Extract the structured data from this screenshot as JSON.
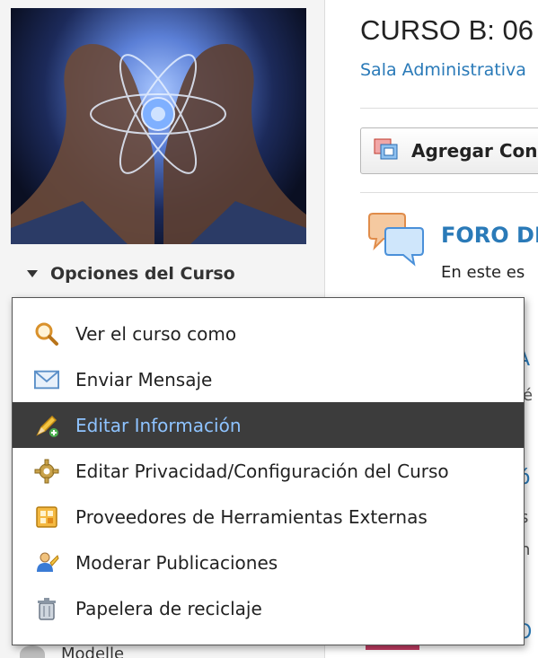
{
  "sidebar": {
    "options_label": "Opciones del Curso",
    "bottom_label": "Modelle"
  },
  "main": {
    "course_title": "CURSO B: 06",
    "course_subtitle": "Sala Administrativa",
    "add_button_label": "Agregar Con",
    "forum_title": "FORO DE",
    "forum_desc": "En este es",
    "fragment_a": "A",
    "fragment_ie": "ié",
    "fragment_o1": "ó",
    "fragment_s": "s",
    "fragment_n": "n",
    "fragment_o2": "O"
  },
  "menu": {
    "items": [
      {
        "label": "Ver el curso como",
        "icon": "magnifier-icon"
      },
      {
        "label": "Enviar Mensaje",
        "icon": "envelope-icon"
      },
      {
        "label": "Editar Información",
        "icon": "pencil-icon",
        "active": true
      },
      {
        "label": "Editar Privacidad/Configuración del Curso",
        "icon": "gear-icon"
      },
      {
        "label": "Proveedores de Herramientas Externas",
        "icon": "tools-icon"
      },
      {
        "label": "Moderar Publicaciones",
        "icon": "user-moderate-icon"
      },
      {
        "label": "Papelera de reciclaje",
        "icon": "recycle-bin-icon"
      }
    ]
  },
  "colors": {
    "link": "#2a7ab8",
    "active_bg": "#3c3c3c",
    "active_text": "#8ec3ff"
  }
}
